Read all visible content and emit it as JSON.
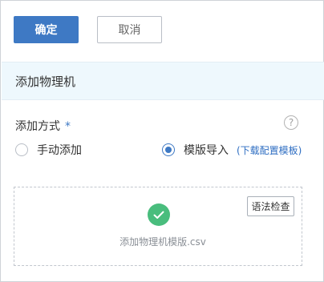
{
  "actions": {
    "confirm_label": "确定",
    "cancel_label": "取消"
  },
  "section": {
    "title": "添加物理机"
  },
  "form": {
    "method_label": "添加方式",
    "required_mark": "*",
    "help_glyph": "?",
    "options": [
      {
        "label": "手动添加",
        "selected": false
      },
      {
        "label": "模版导入",
        "selected": true
      }
    ],
    "download_link": "(下载配置模板)"
  },
  "upload": {
    "check_button": "语法检查",
    "file_name": "添加物理机模版.csv",
    "status_icon": "check-circle-icon",
    "status": "success"
  },
  "colors": {
    "primary": "#3e79c4",
    "header_bg": "#eef8fd",
    "success": "#49bd7d",
    "link": "#2d6dc2"
  }
}
